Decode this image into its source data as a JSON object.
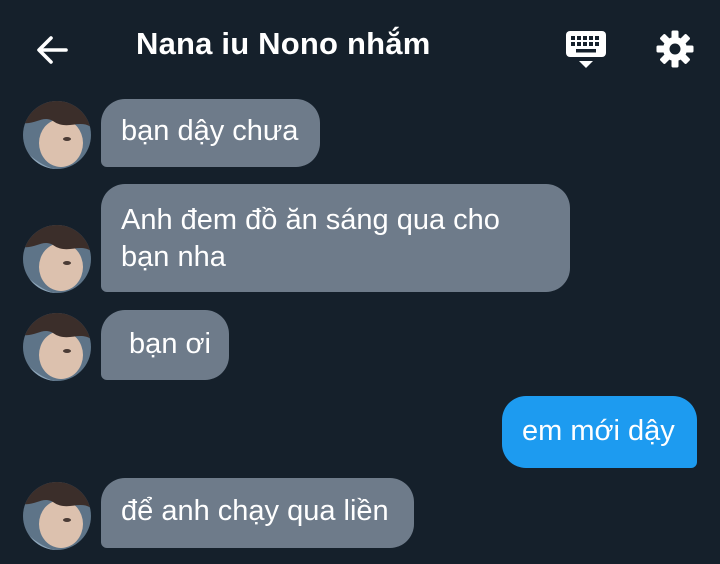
{
  "header": {
    "title": "Nana iu Nono nhắm",
    "back_icon": "arrow-left-icon",
    "keyboard_icon": "keyboard-icon",
    "settings_icon": "gear-icon"
  },
  "messages": [
    {
      "direction": "incoming",
      "lines": [
        "bạn dậy chưa"
      ]
    },
    {
      "direction": "incoming",
      "lines": [
        "Anh đem đồ ăn sáng qua cho",
        "bạn nha"
      ]
    },
    {
      "direction": "incoming",
      "lines": [
        " bạn ơi"
      ]
    },
    {
      "direction": "outgoing",
      "lines": [
        "em mới dậy"
      ]
    },
    {
      "direction": "incoming",
      "lines": [
        "để anh chạy qua liền"
      ]
    }
  ],
  "colors": {
    "background": "#15202b",
    "incoming_bubble": "#6e7b8a",
    "outgoing_bubble": "#1d9bf0",
    "text": "#ffffff"
  }
}
